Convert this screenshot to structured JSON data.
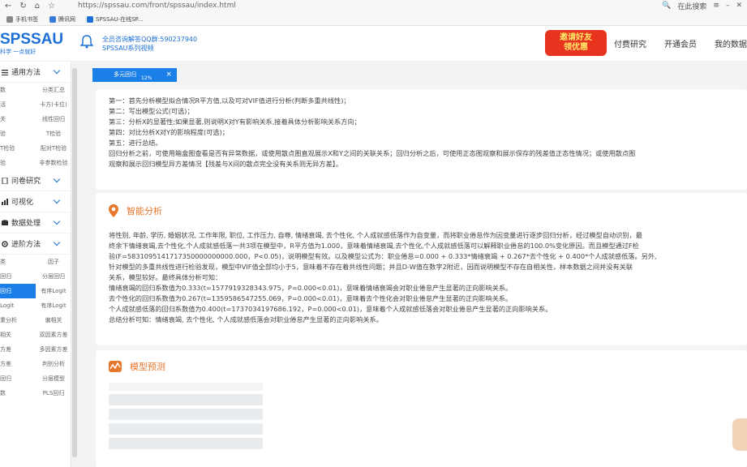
{
  "browser": {
    "url": "https://spssau.com/front/spssau/index.html",
    "search_hint": "在此搜索",
    "bookmarks": [
      {
        "label": "手机书签"
      },
      {
        "label": "腾讯网"
      },
      {
        "label": "SPSSAU-在线SP..."
      }
    ]
  },
  "header": {
    "logo": "SPSSAU",
    "logo_sub": "科学 一点就好",
    "qq_line1": "全员咨询解答QQ群:590237940",
    "qq_line2": "SPSSAU系列视频",
    "promo_line1": "邀请好友",
    "promo_line2": "领优惠",
    "nav": [
      "付费研究",
      "开通会员",
      "我的数据"
    ]
  },
  "sidebar": {
    "sections": [
      {
        "label": "通用方法",
        "items": [
          "数",
          "分类汇总",
          "活",
          "卡方(卡位)",
          "关",
          "线性回归",
          "验",
          "T检验",
          "T检验",
          "配对T检验",
          "验",
          "非参数检验"
        ]
      },
      {
        "label": "问卷研究",
        "items": []
      },
      {
        "label": "可视化",
        "items": []
      },
      {
        "label": "数据处理",
        "items": []
      },
      {
        "label": "进阶方法",
        "items": [
          "类",
          "因子",
          "回归",
          "分层回归",
          "回归",
          "有序Logit",
          "Logit",
          "有序Logit",
          "重分析",
          "偏相关",
          "相关",
          "双因素方差",
          "方差",
          "多因素方差",
          "方差",
          "判别分析",
          "回归",
          "分层模型",
          "数",
          "PLS回归"
        ]
      }
    ]
  },
  "tab": {
    "label": "多元回归",
    "pct": "12%",
    "close": "×"
  },
  "card1": {
    "lines": [
      "第一：首先分析模型拟合情况R平方值,以及可对VIF值进行分析(判断多重共线性)；",
      "第二：写出模型公式(可选)；",
      "第三：分析X的显著性;如果显著,则说明X对Y有影响关系,接着具体分析影响关系方向；",
      "第四：对比分析X对Y的影响程度(可选)；",
      "第五：进行总结。",
      "回归分析之前，可使用箱盒图查看是否有异常数据，或使用散点图直观展示X和Y之间的关联关系；回归分析之后，可使用正态图观察和展示保存的残差值正态性情况；或使用散点图",
      "观察和展示回归模型异方差情况【残差与X间的散点完全没有关系则无异方差】。"
    ]
  },
  "card2": {
    "title": "智能分析",
    "lines": [
      "将性别, 年龄, 学历, 婚姻状况, 工作年限, 职位, 工作压力, 自尊, 情绪衰竭, 去个性化, 个人成就感低落作为自变量，而将职业倦怠作为因变量进行逐步回归分析，经过模型自动识别，最",
      "终余下情绪衰竭,去个性化,个人成就感低落一共3项在模型中，R平方值为1.000，意味着情绪衰竭,去个性化,个人成就感低落可以解释职业倦怠的100.0%变化原因。而且模型通过F检",
      "验(F=5831095141717350000000000.000，P<0.05)，说明模型有效。以及模型公式为：职业倦怠=0.000 + 0.333*情绪衰竭 + 0.267*去个性化 + 0.400*个人成就感低落。另外,",
      "针对模型的多重共线性进行检验发现，模型中VIF值全部均小于5，意味着不存在着共线性问题；并且D-W值在数字2附近，因而说明模型不存在自相关性，样本数据之间并没有关联",
      "关系，模型较好。最终具体分析可知：",
      "情绪衰竭的回归系数值为0.333(t=1577919328343.975，P=0.000<0.01)，意味着情绪衰竭会对职业倦怠产生显著的正向影响关系。",
      "去个性化的回归系数值为0.267(t=1359586547255.069，P=0.000<0.01)，意味着去个性化会对职业倦怠产生显著的正向影响关系。",
      "个人成就感低落的回归系数值为0.400(t=1737034197686.192，P=0.000<0.01)，意味着个人成就感低落会对职业倦怠产生显著的正向影响关系。",
      "总结分析可知：情绪衰竭, 去个性化, 个人成就感低落会对职业倦怠产生显著的正向影响关系。"
    ]
  },
  "card3": {
    "title": "模型预测"
  }
}
